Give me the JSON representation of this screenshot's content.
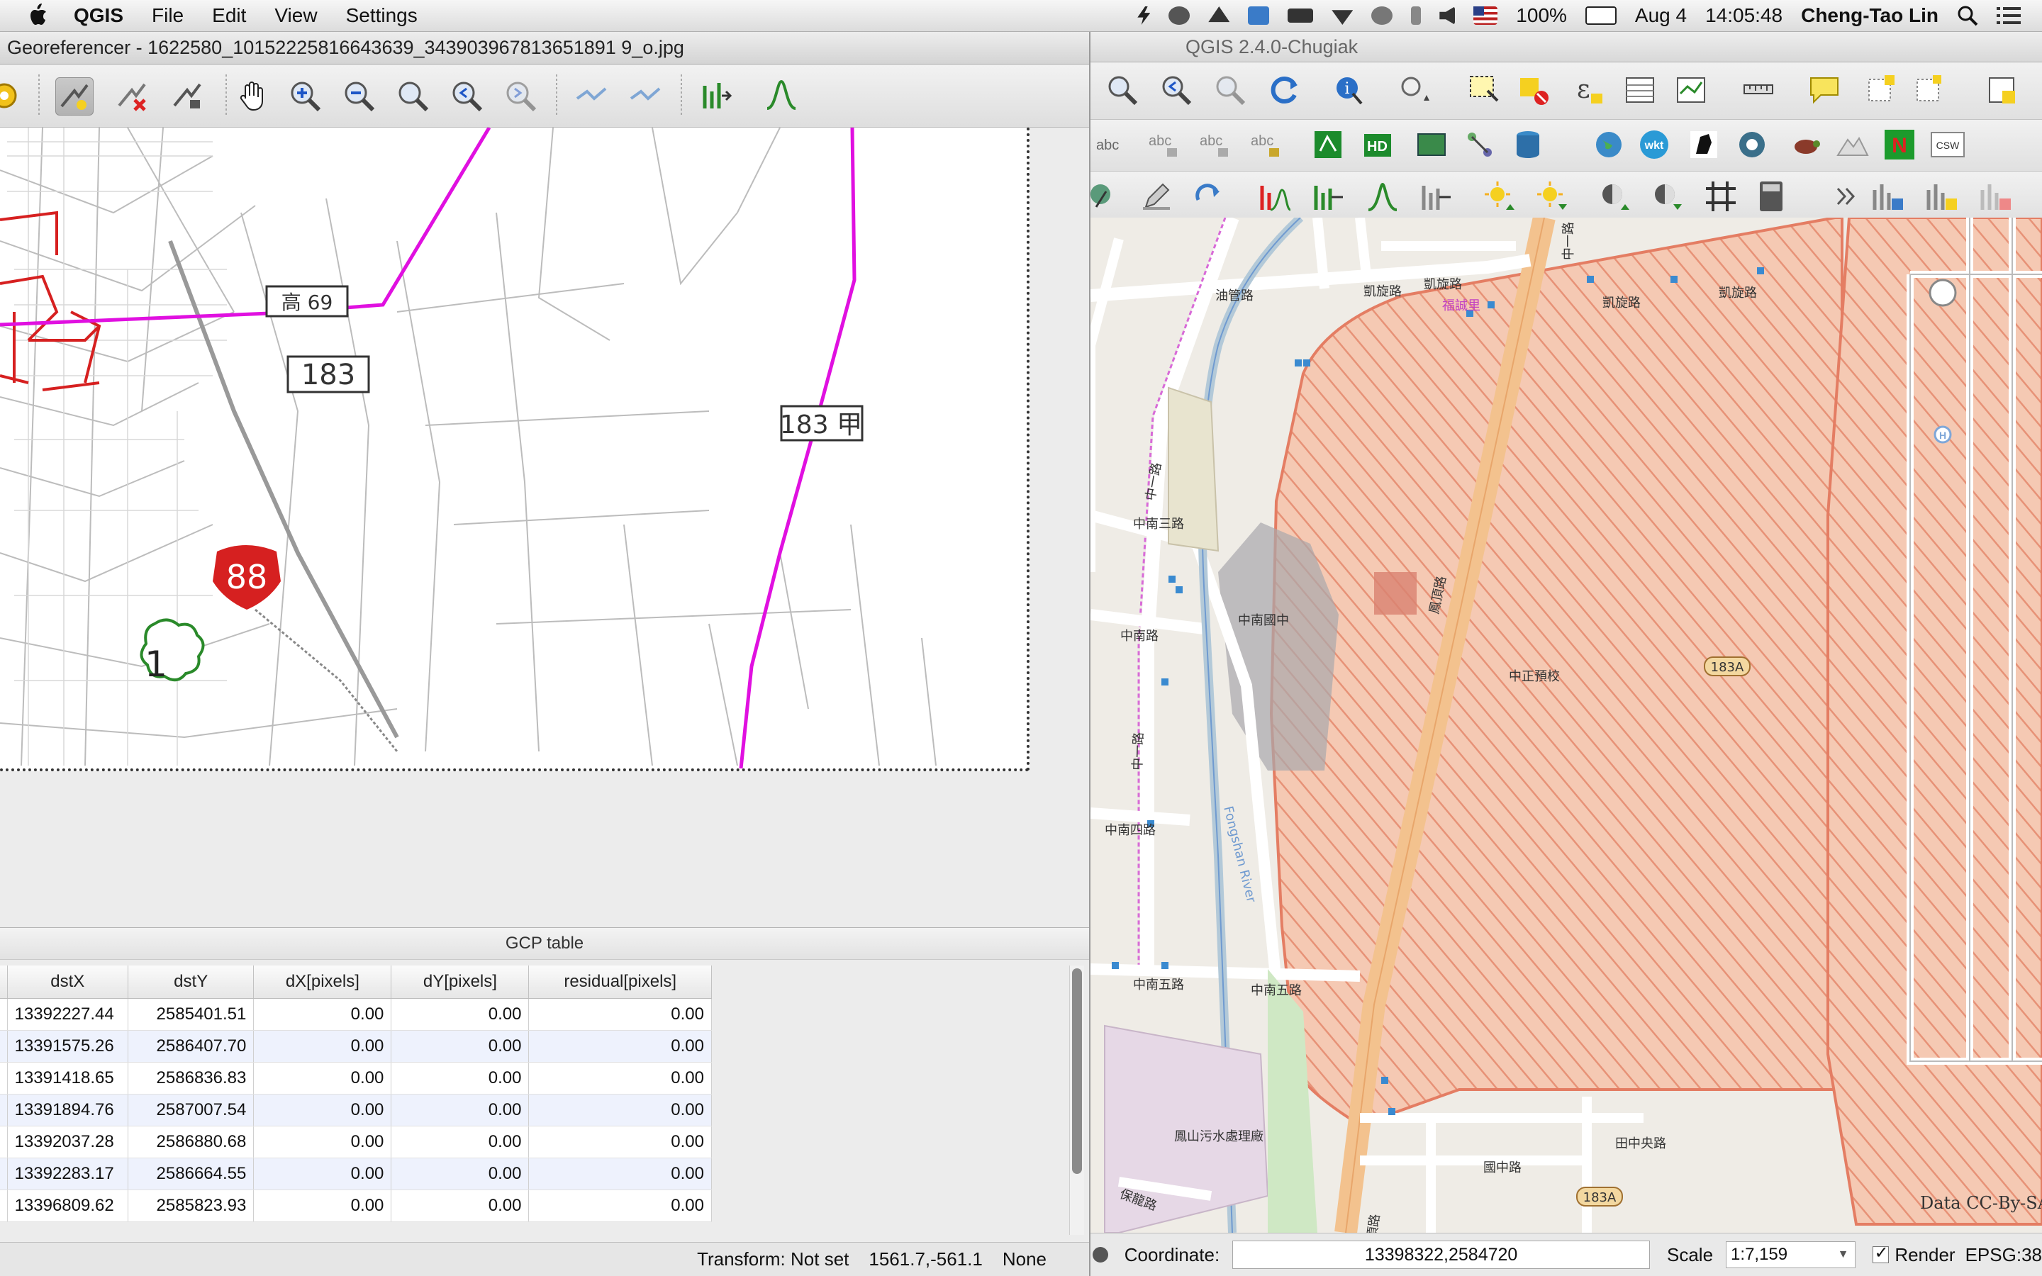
{
  "menubar": {
    "app_name": "QGIS",
    "items": [
      "File",
      "Edit",
      "View",
      "Settings"
    ],
    "battery": "100%",
    "date": "Aug 4",
    "time": "14:05:48",
    "user": "Cheng-Tao Lin"
  },
  "georeferencer": {
    "title": "Georeferencer - 1622580_10152225816643639_343903967813651891 9_o.jpg",
    "map_labels": {
      "route_183": "183",
      "route_183a": "183 甲",
      "route_88": "88",
      "route_1": "1",
      "route_69": "高 69"
    },
    "gcp_table": {
      "title": "GCP table",
      "columns": [
        "dstX",
        "dstY",
        "dX[pixels]",
        "dY[pixels]",
        "residual[pixels]"
      ],
      "rows": [
        [
          "13392227.44",
          "2585401.51",
          "0.00",
          "0.00",
          "0.00"
        ],
        [
          "13391575.26",
          "2586407.70",
          "0.00",
          "0.00",
          "0.00"
        ],
        [
          "13391418.65",
          "2586836.83",
          "0.00",
          "0.00",
          "0.00"
        ],
        [
          "13391894.76",
          "2587007.54",
          "0.00",
          "0.00",
          "0.00"
        ],
        [
          "13392037.28",
          "2586880.68",
          "0.00",
          "0.00",
          "0.00"
        ],
        [
          "13392283.17",
          "2586664.55",
          "0.00",
          "0.00",
          "0.00"
        ],
        [
          "13396809.62",
          "2585823.93",
          "0.00",
          "0.00",
          "0.00"
        ]
      ]
    },
    "status": {
      "transform": "Transform: Not set",
      "coords": "1561.7,-561.1",
      "none": "None"
    }
  },
  "qgis": {
    "title": "QGIS 2.4.0-Chugiak",
    "map_labels": {
      "kaixuan1": "凱旋路",
      "kaixuan2": "凱旋路",
      "kaixuan3": "凱旋路",
      "kaixuan4": "凱旋路",
      "youguan": "油管路",
      "zhongnan3": "中南三路",
      "zhongnan_school": "中南國中",
      "zhongnan_rd": "中南路",
      "zhongnan4": "中南四路",
      "zhongnan5a": "中南五路",
      "zhongnan5b": "中南五路",
      "zhongzheng": "中正預校",
      "route_183a_1": "183A",
      "route_183a_2": "183A",
      "fengshan_river": "Fongshan River",
      "sewage": "鳳山污水處理廠",
      "baolong": "保龍路",
      "tianzhong": "田中央路",
      "guozhong": "國中路",
      "fengyu1": "鳳頂路",
      "fengyu2": "鳳頂路",
      "zhongyi1": "中一路",
      "zhongyi2": "中一路",
      "zhongyi3": "中一路",
      "district": "福誠里",
      "attribution": "Data CC-By-SA b"
    },
    "status": {
      "coordinate_label": "Coordinate:",
      "coordinate_value": "13398322,2584720",
      "scale_label": "Scale",
      "scale_value": "1:7,159",
      "render_label": "Render",
      "crs": "EPSG:38"
    }
  }
}
